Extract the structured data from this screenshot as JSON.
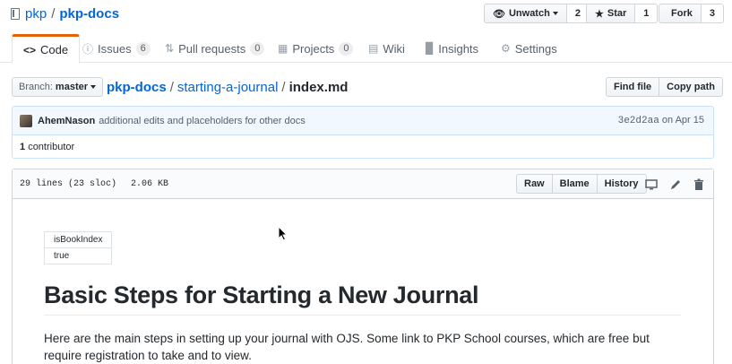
{
  "repo": {
    "owner": "pkp",
    "separator": "/",
    "name": "pkp-docs"
  },
  "actions": {
    "watch": {
      "label": "Unwatch",
      "count": "2"
    },
    "star": {
      "label": "Star",
      "count": "1"
    },
    "fork": {
      "label": "Fork",
      "count": "3"
    }
  },
  "tabs": [
    {
      "label": "Code",
      "icon": "code-icon",
      "active": true
    },
    {
      "label": "Issues",
      "icon": "issue-icon",
      "count": "6"
    },
    {
      "label": "Pull requests",
      "icon": "pull-request-icon",
      "count": "0"
    },
    {
      "label": "Projects",
      "icon": "project-icon",
      "count": "0"
    },
    {
      "label": "Wiki",
      "icon": "book-icon"
    },
    {
      "label": "Insights",
      "icon": "graph-icon"
    },
    {
      "label": "Settings",
      "icon": "gear-icon"
    }
  ],
  "branch": {
    "prefix": "Branch:",
    "name": "master"
  },
  "breadcrumb": {
    "root": "pkp-docs",
    "dir": "starting-a-journal",
    "file": "index.md",
    "sep": "/"
  },
  "file_actions": {
    "find": "Find file",
    "copy": "Copy path"
  },
  "commit": {
    "author": "AhemNason",
    "message": "additional edits and placeholders for other docs",
    "sha": "3e2d2aa",
    "date_prefix": "on",
    "date": "Apr 15"
  },
  "contributors": {
    "count": "1",
    "label": "contributor"
  },
  "file_info": {
    "lines": "29 lines (23 sloc)",
    "size": "2.06 KB"
  },
  "file_buttons": {
    "raw": "Raw",
    "blame": "Blame",
    "history": "History"
  },
  "content": {
    "table": {
      "header": "isBookIndex",
      "value": "true"
    },
    "heading": "Basic Steps for Starting a New Journal",
    "paragraph": "Here are the main steps in setting up your journal with OJS. Some link to PKP School courses, which are free but require registration to take and to view."
  }
}
